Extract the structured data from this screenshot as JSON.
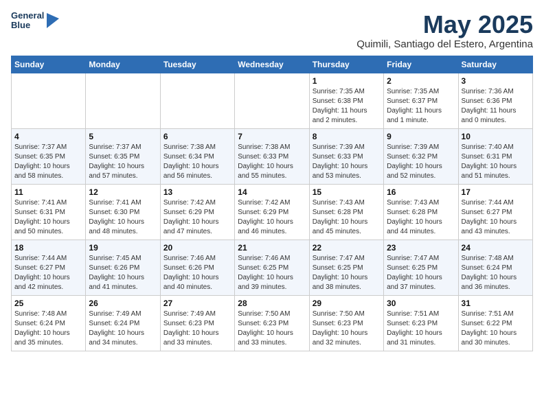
{
  "header": {
    "logo_line1": "General",
    "logo_line2": "Blue",
    "title": "May 2025",
    "subtitle": "Quimili, Santiago del Estero, Argentina"
  },
  "days_of_week": [
    "Sunday",
    "Monday",
    "Tuesday",
    "Wednesday",
    "Thursday",
    "Friday",
    "Saturday"
  ],
  "weeks": [
    [
      {
        "day": "",
        "info": ""
      },
      {
        "day": "",
        "info": ""
      },
      {
        "day": "",
        "info": ""
      },
      {
        "day": "",
        "info": ""
      },
      {
        "day": "1",
        "info": "Sunrise: 7:35 AM\nSunset: 6:38 PM\nDaylight: 11 hours\nand 2 minutes."
      },
      {
        "day": "2",
        "info": "Sunrise: 7:35 AM\nSunset: 6:37 PM\nDaylight: 11 hours\nand 1 minute."
      },
      {
        "day": "3",
        "info": "Sunrise: 7:36 AM\nSunset: 6:36 PM\nDaylight: 11 hours\nand 0 minutes."
      }
    ],
    [
      {
        "day": "4",
        "info": "Sunrise: 7:37 AM\nSunset: 6:35 PM\nDaylight: 10 hours\nand 58 minutes."
      },
      {
        "day": "5",
        "info": "Sunrise: 7:37 AM\nSunset: 6:35 PM\nDaylight: 10 hours\nand 57 minutes."
      },
      {
        "day": "6",
        "info": "Sunrise: 7:38 AM\nSunset: 6:34 PM\nDaylight: 10 hours\nand 56 minutes."
      },
      {
        "day": "7",
        "info": "Sunrise: 7:38 AM\nSunset: 6:33 PM\nDaylight: 10 hours\nand 55 minutes."
      },
      {
        "day": "8",
        "info": "Sunrise: 7:39 AM\nSunset: 6:33 PM\nDaylight: 10 hours\nand 53 minutes."
      },
      {
        "day": "9",
        "info": "Sunrise: 7:39 AM\nSunset: 6:32 PM\nDaylight: 10 hours\nand 52 minutes."
      },
      {
        "day": "10",
        "info": "Sunrise: 7:40 AM\nSunset: 6:31 PM\nDaylight: 10 hours\nand 51 minutes."
      }
    ],
    [
      {
        "day": "11",
        "info": "Sunrise: 7:41 AM\nSunset: 6:31 PM\nDaylight: 10 hours\nand 50 minutes."
      },
      {
        "day": "12",
        "info": "Sunrise: 7:41 AM\nSunset: 6:30 PM\nDaylight: 10 hours\nand 48 minutes."
      },
      {
        "day": "13",
        "info": "Sunrise: 7:42 AM\nSunset: 6:29 PM\nDaylight: 10 hours\nand 47 minutes."
      },
      {
        "day": "14",
        "info": "Sunrise: 7:42 AM\nSunset: 6:29 PM\nDaylight: 10 hours\nand 46 minutes."
      },
      {
        "day": "15",
        "info": "Sunrise: 7:43 AM\nSunset: 6:28 PM\nDaylight: 10 hours\nand 45 minutes."
      },
      {
        "day": "16",
        "info": "Sunrise: 7:43 AM\nSunset: 6:28 PM\nDaylight: 10 hours\nand 44 minutes."
      },
      {
        "day": "17",
        "info": "Sunrise: 7:44 AM\nSunset: 6:27 PM\nDaylight: 10 hours\nand 43 minutes."
      }
    ],
    [
      {
        "day": "18",
        "info": "Sunrise: 7:44 AM\nSunset: 6:27 PM\nDaylight: 10 hours\nand 42 minutes."
      },
      {
        "day": "19",
        "info": "Sunrise: 7:45 AM\nSunset: 6:26 PM\nDaylight: 10 hours\nand 41 minutes."
      },
      {
        "day": "20",
        "info": "Sunrise: 7:46 AM\nSunset: 6:26 PM\nDaylight: 10 hours\nand 40 minutes."
      },
      {
        "day": "21",
        "info": "Sunrise: 7:46 AM\nSunset: 6:25 PM\nDaylight: 10 hours\nand 39 minutes."
      },
      {
        "day": "22",
        "info": "Sunrise: 7:47 AM\nSunset: 6:25 PM\nDaylight: 10 hours\nand 38 minutes."
      },
      {
        "day": "23",
        "info": "Sunrise: 7:47 AM\nSunset: 6:25 PM\nDaylight: 10 hours\nand 37 minutes."
      },
      {
        "day": "24",
        "info": "Sunrise: 7:48 AM\nSunset: 6:24 PM\nDaylight: 10 hours\nand 36 minutes."
      }
    ],
    [
      {
        "day": "25",
        "info": "Sunrise: 7:48 AM\nSunset: 6:24 PM\nDaylight: 10 hours\nand 35 minutes."
      },
      {
        "day": "26",
        "info": "Sunrise: 7:49 AM\nSunset: 6:24 PM\nDaylight: 10 hours\nand 34 minutes."
      },
      {
        "day": "27",
        "info": "Sunrise: 7:49 AM\nSunset: 6:23 PM\nDaylight: 10 hours\nand 33 minutes."
      },
      {
        "day": "28",
        "info": "Sunrise: 7:50 AM\nSunset: 6:23 PM\nDaylight: 10 hours\nand 33 minutes."
      },
      {
        "day": "29",
        "info": "Sunrise: 7:50 AM\nSunset: 6:23 PM\nDaylight: 10 hours\nand 32 minutes."
      },
      {
        "day": "30",
        "info": "Sunrise: 7:51 AM\nSunset: 6:23 PM\nDaylight: 10 hours\nand 31 minutes."
      },
      {
        "day": "31",
        "info": "Sunrise: 7:51 AM\nSunset: 6:22 PM\nDaylight: 10 hours\nand 30 minutes."
      }
    ]
  ]
}
